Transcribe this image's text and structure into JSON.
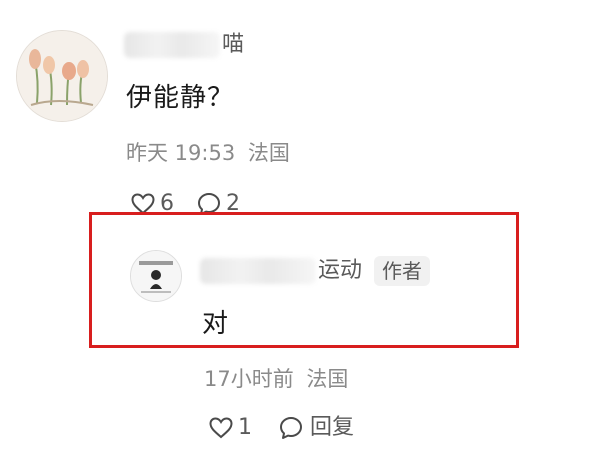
{
  "main_comment": {
    "username_visible_part": "喵",
    "text": "伊能静？",
    "time": "昨天 19:53",
    "location": "法国",
    "likes": "6",
    "replies": "2"
  },
  "reply": {
    "username_visible_part": "运动",
    "author_tag": "作者",
    "text": "对",
    "time": "17小时前",
    "location": "法国",
    "likes": "1",
    "reply_label": "回复"
  },
  "colors": {
    "highlight_border": "#d81e1e",
    "meta_text": "#8a8a8a",
    "body_text": "#1a1a1a"
  },
  "icons": {
    "like": "heart-outline-icon",
    "comment": "speech-bubble-outline-icon"
  }
}
